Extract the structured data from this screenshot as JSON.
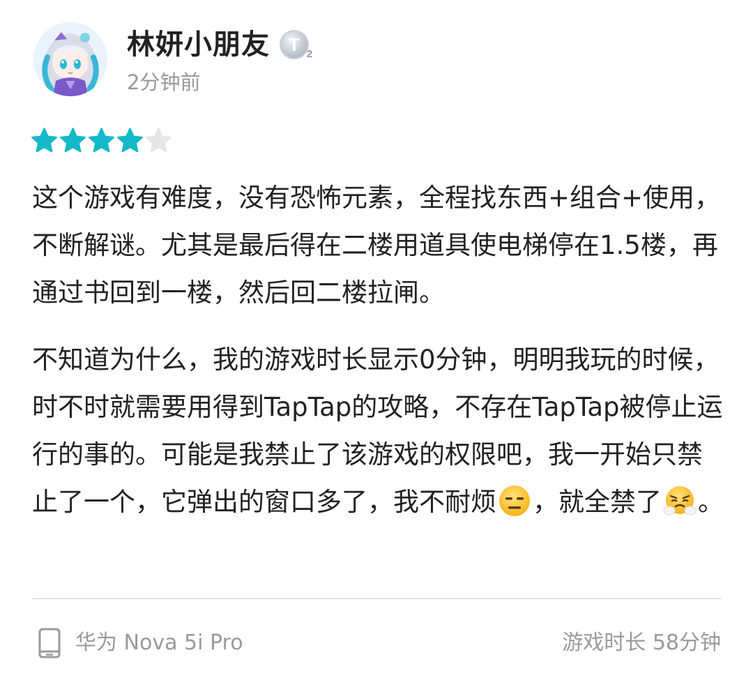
{
  "user": {
    "name": "林妍小朋友",
    "badge_text": "T",
    "badge_sub": "2",
    "time_ago": "2分钟前",
    "avatar_icon": "anime-character-avatar"
  },
  "rating": {
    "value": 4,
    "max": 5,
    "filled_color": "#14b9c8",
    "empty_color": "#e6e6e6"
  },
  "review": {
    "p1": "这个游戏有难度，没有恐怖元素，全程找东西+组合+使用，不断解谜。尤其是最后得在二楼用道具使电梯停在1.5楼，再通过书回到一楼，然后回二楼拉闸。",
    "p2_part1": "不知道为什么，我的游戏时长显示0分钟，明明我玩的时候，时不时就需要用得到TapTap的攻略，不存在TapTap被停止运行的事的。可能是我禁止了该游戏的权限吧，我一开始只禁止了一个，它弹出的窗口多了，我不耐烦",
    "p2_part2": "，就全禁了",
    "p2_part3": "。",
    "emoji1": "expressionless-face-emoji",
    "emoji2": "face-with-steam-emoji"
  },
  "footer": {
    "device": "华为 Nova 5i Pro",
    "device_icon": "phone-icon",
    "playtime": "游戏时长 58分钟"
  }
}
